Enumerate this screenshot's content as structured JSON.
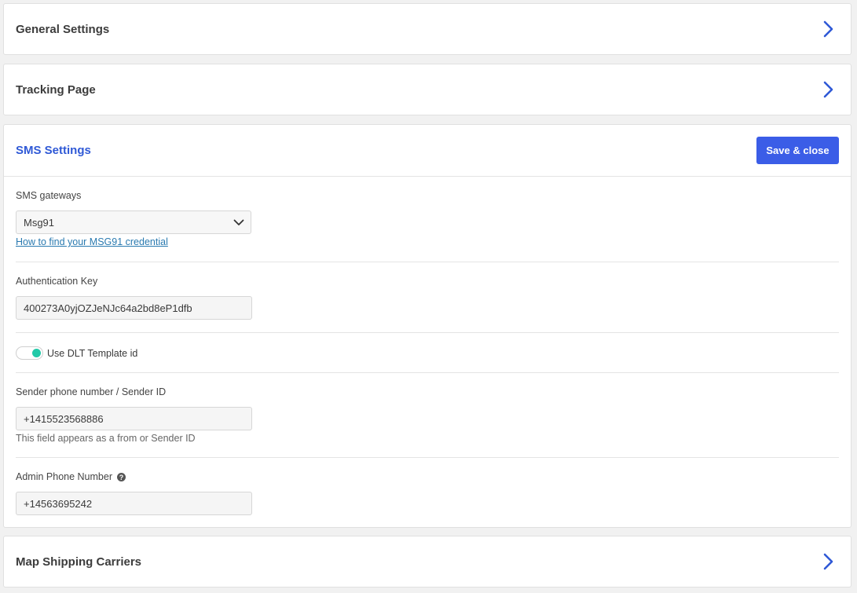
{
  "panels": {
    "general": {
      "title": "General Settings"
    },
    "tracking": {
      "title": "Tracking Page"
    },
    "shipping": {
      "title": "Map Shipping Carriers"
    }
  },
  "sms": {
    "title": "SMS Settings",
    "save_label": "Save & close",
    "gateway": {
      "label": "SMS gateways",
      "selected": "Msg91",
      "help_link": "How to find your MSG91 credential"
    },
    "auth_key": {
      "label": "Authentication Key",
      "value": "400273A0yjOZJeNJc64a2bd8eP1dfb"
    },
    "dlt": {
      "label": "Use DLT Template id",
      "enabled": true
    },
    "sender": {
      "label": "Sender phone number / Sender ID",
      "value": "+1415523568886",
      "helper": "This field appears as a from or Sender ID"
    },
    "admin_phone": {
      "label": "Admin Phone Number",
      "help_glyph": "?",
      "value": "+14563695242"
    }
  },
  "colors": {
    "accent": "#3b5de7",
    "title_blue": "#2f59d6",
    "toggle_on": "#22c9a8",
    "link": "#2a7ab0"
  }
}
